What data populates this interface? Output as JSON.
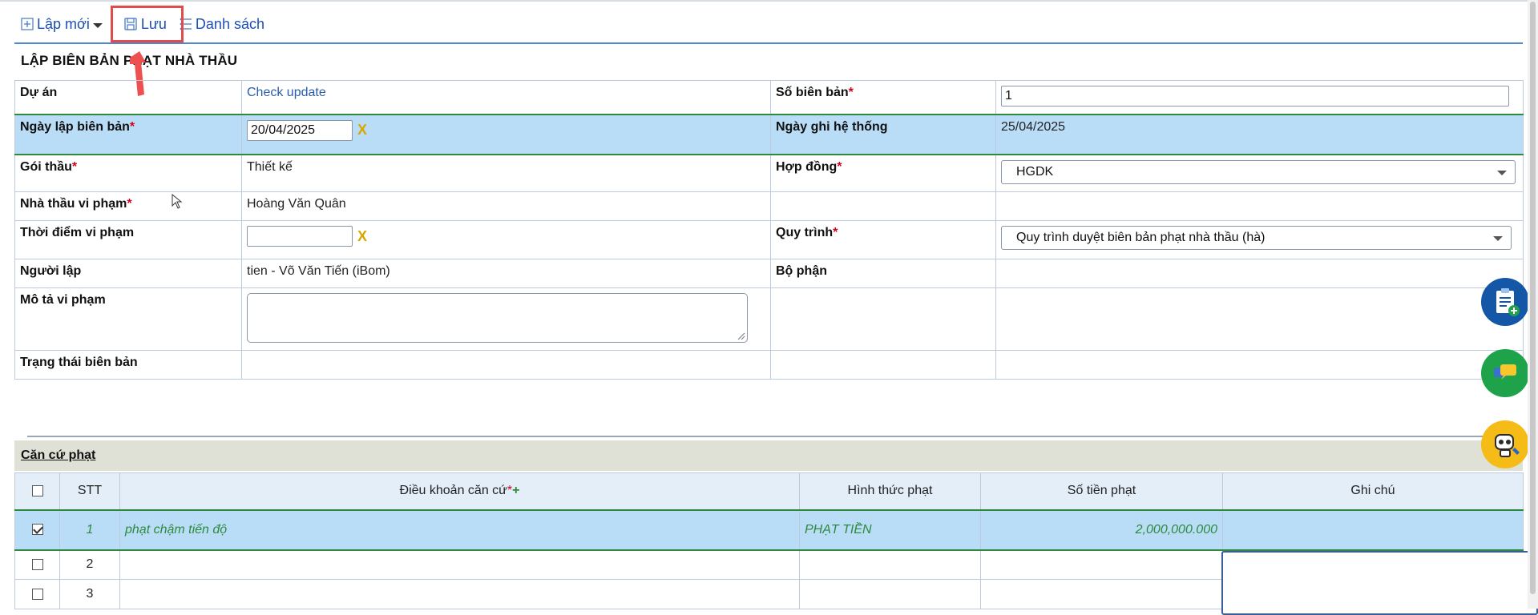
{
  "toolbar": {
    "new_label": "Lập mới",
    "save_label": "Lưu",
    "list_label": "Danh sách"
  },
  "form": {
    "title": "LẬP BIÊN BẢN PHẠT NHÀ THẦU",
    "project_label": "Dự án",
    "project_value": "Check update",
    "report_no_label": "Số biên bản",
    "report_no_value": "1",
    "date_label": "Ngày lập biên bản",
    "date_value": "20/04/2025",
    "sys_date_label": "Ngày ghi hệ thống",
    "sys_date_value": "25/04/2025",
    "package_label": "Gói thầu",
    "package_value": "Thiết kế",
    "contract_label": "Hợp đồng",
    "contract_value": "HGDK",
    "contractor_label": "Nhà thầu vi phạm",
    "contractor_value": "Hoàng Văn Quân",
    "violation_time_label": "Thời điểm vi phạm",
    "violation_time_value": "",
    "process_label": "Quy trình",
    "process_value": "Quy trình duyệt biên bản phạt nhà thầu (hà)",
    "creator_label": "Người lập",
    "creator_value": "tien - Võ Văn Tiến (iBom)",
    "dept_label": "Bộ phận",
    "desc_label": "Mô tả vi phạm",
    "status_label": "Trạng thái biên bản",
    "required_mark": "*",
    "clear_mark": "X"
  },
  "section": {
    "title": "Căn cứ phạt",
    "columns": {
      "stt": "STT",
      "clause": "Điều khoản căn cứ",
      "form": "Hình thức phạt",
      "amount": "Số tiền phạt",
      "note": "Ghi chú"
    },
    "add_mark": "+",
    "rows": [
      {
        "checked": true,
        "stt": "1",
        "clause": "phạt chậm tiến độ",
        "form": "PHẠT TIỀN",
        "amount": "2,000,000.000",
        "note": ""
      },
      {
        "checked": false,
        "stt": "2",
        "clause": "",
        "form": "",
        "amount": "",
        "note": ""
      },
      {
        "checked": false,
        "stt": "3",
        "clause": "",
        "form": "",
        "amount": "",
        "note": ""
      }
    ]
  },
  "colors": {
    "accent": "#1a4fb5",
    "highlight_row": "#b9dcf7",
    "selected_border": "#2d8a3c",
    "required": "#d0021b",
    "save_box": "#e04b4b"
  },
  "icons": [
    "plus-square-icon",
    "save-disk-icon",
    "list-icon",
    "calendar-clear-icon",
    "clipboard-add-icon",
    "chat-icon",
    "robot-support-icon"
  ]
}
